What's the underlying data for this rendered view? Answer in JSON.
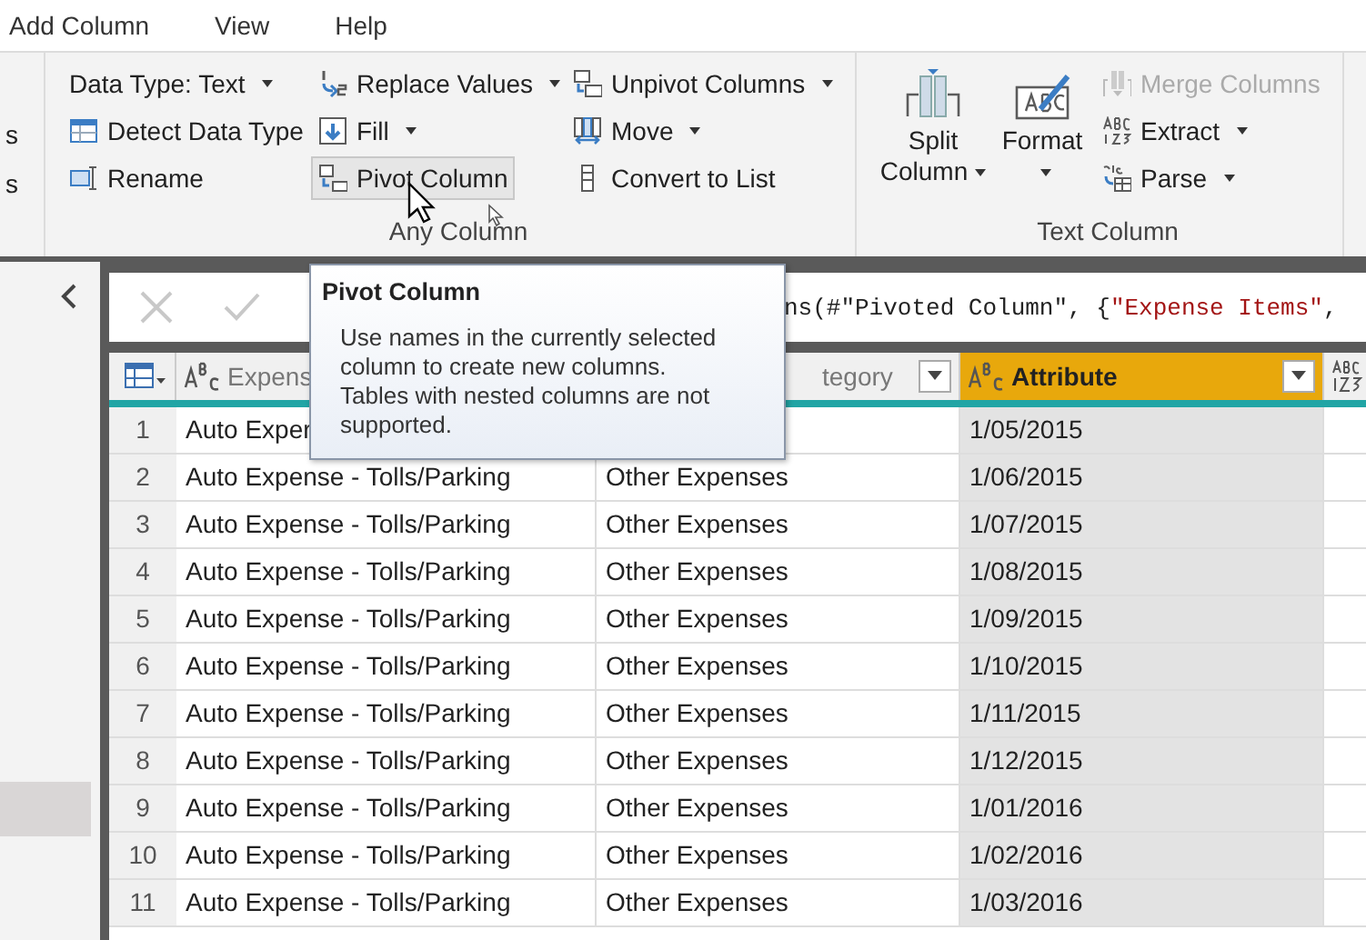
{
  "menu": [
    "Add Column",
    "View",
    "Help"
  ],
  "ribbon": {
    "cut_labels": [
      "s",
      "s"
    ],
    "groups": [
      {
        "label": "Any Column",
        "columns": [
          [
            {
              "label": "Data Type: Text",
              "kind": "small",
              "dropdown": true,
              "disabled": false,
              "hovered": false
            },
            {
              "label": "Detect Data Type",
              "kind": "small",
              "dropdown": false,
              "disabled": false,
              "hovered": false
            },
            {
              "label": "Rename",
              "kind": "small",
              "dropdown": false,
              "disabled": false,
              "hovered": false
            }
          ],
          [
            {
              "label": "Replace Values",
              "kind": "small",
              "dropdown": true,
              "disabled": false,
              "hovered": false
            },
            {
              "label": "Fill",
              "kind": "small",
              "dropdown": true,
              "disabled": false,
              "hovered": false
            },
            {
              "label": "Pivot Column",
              "kind": "small",
              "dropdown": false,
              "disabled": false,
              "hovered": true
            }
          ],
          [
            {
              "label": "Unpivot Columns",
              "kind": "small",
              "dropdown": true,
              "disabled": false,
              "hovered": false
            },
            {
              "label": "Move",
              "kind": "small",
              "dropdown": true,
              "disabled": false,
              "hovered": false
            },
            {
              "label": "Convert to List",
              "kind": "small",
              "dropdown": false,
              "disabled": false,
              "hovered": false
            }
          ]
        ]
      },
      {
        "label": "Text Column",
        "columns": [
          [
            {
              "label": "Split Column",
              "kind": "large",
              "dropdown": true,
              "disabled": false,
              "hovered": false
            }
          ],
          [
            {
              "label": "Format",
              "kind": "large",
              "dropdown": true,
              "disabled": false,
              "hovered": false
            }
          ],
          [
            {
              "label": "Merge Columns",
              "kind": "small",
              "dropdown": false,
              "disabled": true,
              "hovered": false
            },
            {
              "label": "Extract",
              "kind": "small",
              "dropdown": true,
              "disabled": false,
              "hovered": false
            },
            {
              "label": "Parse",
              "kind": "small",
              "dropdown": true,
              "disabled": false,
              "hovered": false
            }
          ]
        ]
      }
    ]
  },
  "formula": [
    {
      "text": "ns(#\"Pivoted Column\", {",
      "kind": "code"
    },
    {
      "text": "\"Expense Items\"",
      "kind": "string"
    },
    {
      "text": ",",
      "kind": "code"
    }
  ],
  "tooltip": {
    "title": "Pivot Column",
    "body": "Use names in the currently selected column to create new columns. Tables with nested columns are not supported."
  },
  "table": {
    "columns": [
      {
        "label": "Expens",
        "kind": "text",
        "selected": false
      },
      {
        "label": "tegory",
        "selected": false,
        "filter": true
      },
      {
        "label": "Attribute",
        "kind": "text",
        "selected": true,
        "filter": true
      },
      {
        "kind": "any",
        "selected": false
      }
    ],
    "rows": [
      {
        "number": "1",
        "cells": [
          "Auto Exper",
          null,
          "1/05/2015"
        ]
      },
      {
        "number": "2",
        "cells": [
          "Auto Expense - Tolls/Parking",
          "Other Expenses",
          "1/06/2015"
        ]
      },
      {
        "number": "3",
        "cells": [
          "Auto Expense - Tolls/Parking",
          "Other Expenses",
          "1/07/2015"
        ]
      },
      {
        "number": "4",
        "cells": [
          "Auto Expense - Tolls/Parking",
          "Other Expenses",
          "1/08/2015"
        ]
      },
      {
        "number": "5",
        "cells": [
          "Auto Expense - Tolls/Parking",
          "Other Expenses",
          "1/09/2015"
        ]
      },
      {
        "number": "6",
        "cells": [
          "Auto Expense - Tolls/Parking",
          "Other Expenses",
          "1/10/2015"
        ]
      },
      {
        "number": "7",
        "cells": [
          "Auto Expense - Tolls/Parking",
          "Other Expenses",
          "1/11/2015"
        ]
      },
      {
        "number": "8",
        "cells": [
          "Auto Expense - Tolls/Parking",
          "Other Expenses",
          "1/12/2015"
        ]
      },
      {
        "number": "9",
        "cells": [
          "Auto Expense - Tolls/Parking",
          "Other Expenses",
          "1/01/2016"
        ]
      },
      {
        "number": "10",
        "cells": [
          "Auto Expense - Tolls/Parking",
          "Other Expenses",
          "1/02/2016"
        ]
      },
      {
        "number": "11",
        "cells": [
          "Auto Expense - Tolls/Parking",
          "Other Expenses",
          "1/03/2016"
        ]
      }
    ]
  }
}
